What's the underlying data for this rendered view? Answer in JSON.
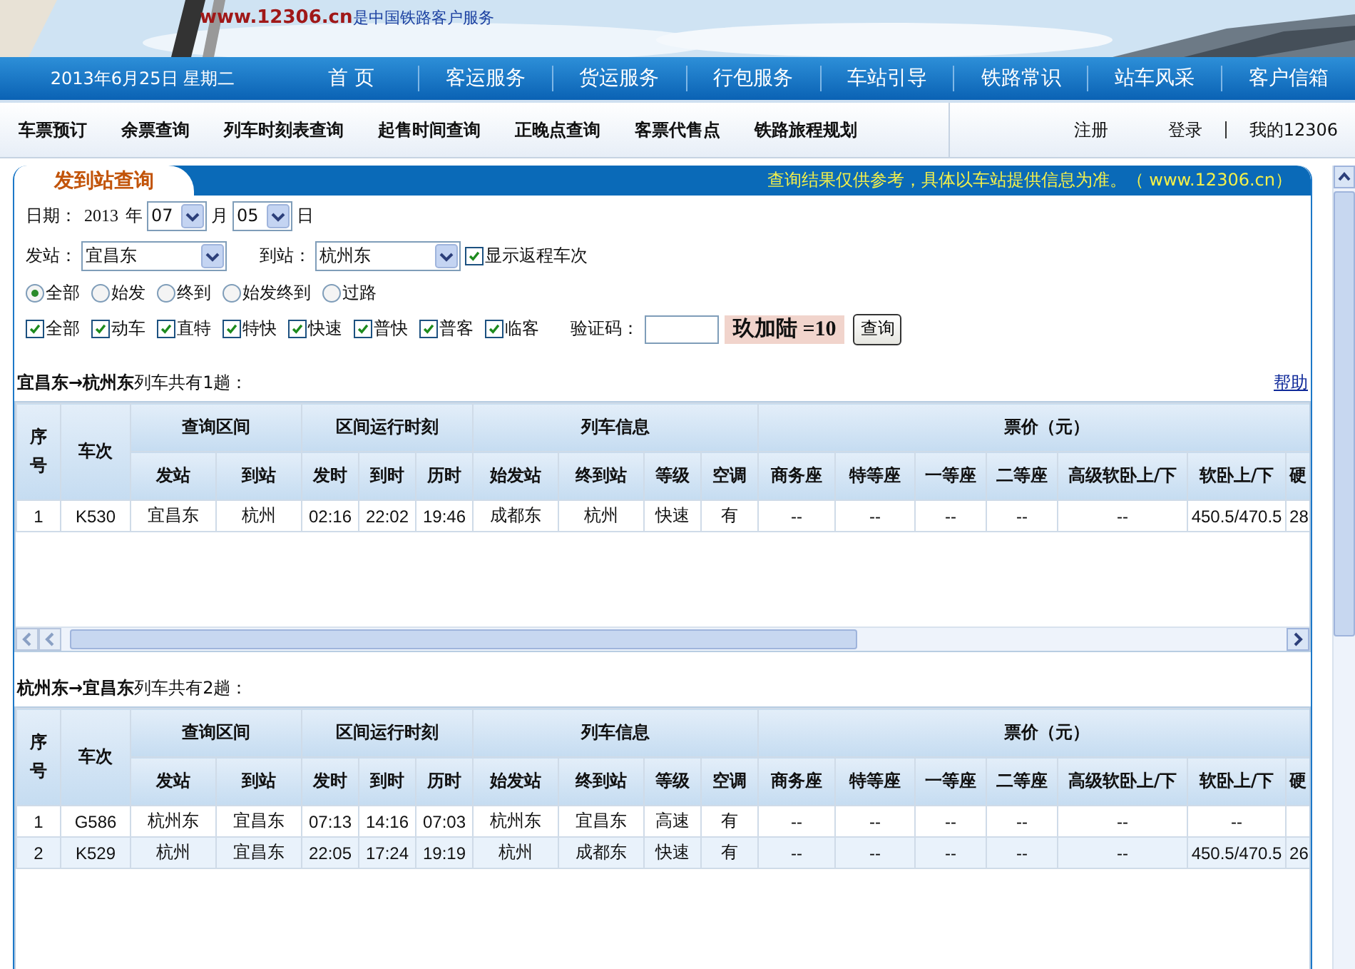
{
  "banner": {
    "tagline": "**www.12306.cn**是中国铁路客户服务"
  },
  "date_bar": "2013年6月25日 星期二",
  "main_nav": [
    "首 页",
    "客运服务",
    "货运服务",
    "行包服务",
    "车站引导",
    "铁路常识",
    "站车风采",
    "客户信箱"
  ],
  "sub_nav": [
    "车票预订",
    "余票查询",
    "列车时刻表查询",
    "起售时间查询",
    "正晚点查询",
    "客票代售点",
    "铁路旅程规划"
  ],
  "account_links": [
    "注册",
    "登录",
    "我的12306"
  ],
  "panel": {
    "title": "发到站查询",
    "notice": "查询结果仅供参考，具体以车站提供信息为准。（ www.12306.cn）"
  },
  "form": {
    "date_label": "日期：",
    "year": "2013",
    "year_unit": "年",
    "month": "07",
    "month_unit": "月",
    "day": "05",
    "day_unit": "日",
    "from_label": "发站：",
    "from": "宜昌东",
    "to_label": "到站：",
    "to": "杭州东",
    "return_option": {
      "label": "显示返程车次",
      "checked": true
    },
    "stop_types": [
      {
        "label": "全部",
        "selected": true
      },
      {
        "label": "始发",
        "selected": false
      },
      {
        "label": "终到",
        "selected": false
      },
      {
        "label": "始发终到",
        "selected": false
      },
      {
        "label": "过路",
        "selected": false
      }
    ],
    "train_types": [
      {
        "label": "全部",
        "checked": true
      },
      {
        "label": "动车",
        "checked": true
      },
      {
        "label": "直特",
        "checked": true
      },
      {
        "label": "特快",
        "checked": true
      },
      {
        "label": "快速",
        "checked": true
      },
      {
        "label": "普快",
        "checked": true
      },
      {
        "label": "普客",
        "checked": true
      },
      {
        "label": "临客",
        "checked": true
      }
    ],
    "captcha_label": "验证码：",
    "captcha_image": "玖加陆 =10",
    "submit": "查询"
  },
  "results": [
    {
      "title": "**宜昌东→杭州东**列车共有1趟：",
      "help_link": "帮助",
      "scrollbar": true,
      "columns": [
        {
          "label": "序号"
        },
        {
          "label": "车次"
        },
        {
          "label": "查询区间",
          "colspan": 2,
          "children": [
            "发站",
            "到站"
          ]
        },
        {
          "label": "区间运行时刻",
          "colspan": 3,
          "children": [
            "发时",
            "到时",
            "历时"
          ]
        },
        {
          "label": "列车信息",
          "colspan": 4,
          "children": [
            "始发站",
            "终到站",
            "等级",
            "空调"
          ]
        },
        {
          "label": "票价（元）",
          "colspan": 7,
          "children": [
            "商务座",
            "特等座",
            "一等座",
            "二等座",
            "高级软卧上/下",
            "软卧上/下",
            "硬"
          ]
        }
      ],
      "rows": [
        [
          "1",
          "K530",
          "宜昌东",
          "杭州",
          "02:16",
          "22:02",
          "19:46",
          "成都东",
          "杭州",
          "快速",
          "有",
          "--",
          "--",
          "--",
          "--",
          "--",
          "450.5/470.5",
          "28"
        ]
      ]
    },
    {
      "title": "**杭州东→宜昌东**列车共有2趟：",
      "scrollbar": false,
      "columns": [
        {
          "label": "序号"
        },
        {
          "label": "车次"
        },
        {
          "label": "查询区间",
          "colspan": 2,
          "children": [
            "发站",
            "到站"
          ]
        },
        {
          "label": "区间运行时刻",
          "colspan": 3,
          "children": [
            "发时",
            "到时",
            "历时"
          ]
        },
        {
          "label": "列车信息",
          "colspan": 4,
          "children": [
            "始发站",
            "终到站",
            "等级",
            "空调"
          ]
        },
        {
          "label": "票价（元）",
          "colspan": 7,
          "children": [
            "商务座",
            "特等座",
            "一等座",
            "二等座",
            "高级软卧上/下",
            "软卧上/下",
            "硬"
          ]
        }
      ],
      "rows": [
        [
          "1",
          "G586",
          "杭州东",
          "宜昌东",
          "07:13",
          "14:16",
          "07:03",
          "杭州东",
          "宜昌东",
          "高速",
          "有",
          "--",
          "--",
          "--",
          "--",
          "--",
          "--"
        ],
        [
          "2",
          "K529",
          "杭州",
          "宜昌东",
          "22:05",
          "17:24",
          "19:19",
          "杭州",
          "成都东",
          "快速",
          "有",
          "--",
          "--",
          "--",
          "--",
          "--",
          "450.5/470.5",
          "26"
        ]
      ]
    }
  ]
}
